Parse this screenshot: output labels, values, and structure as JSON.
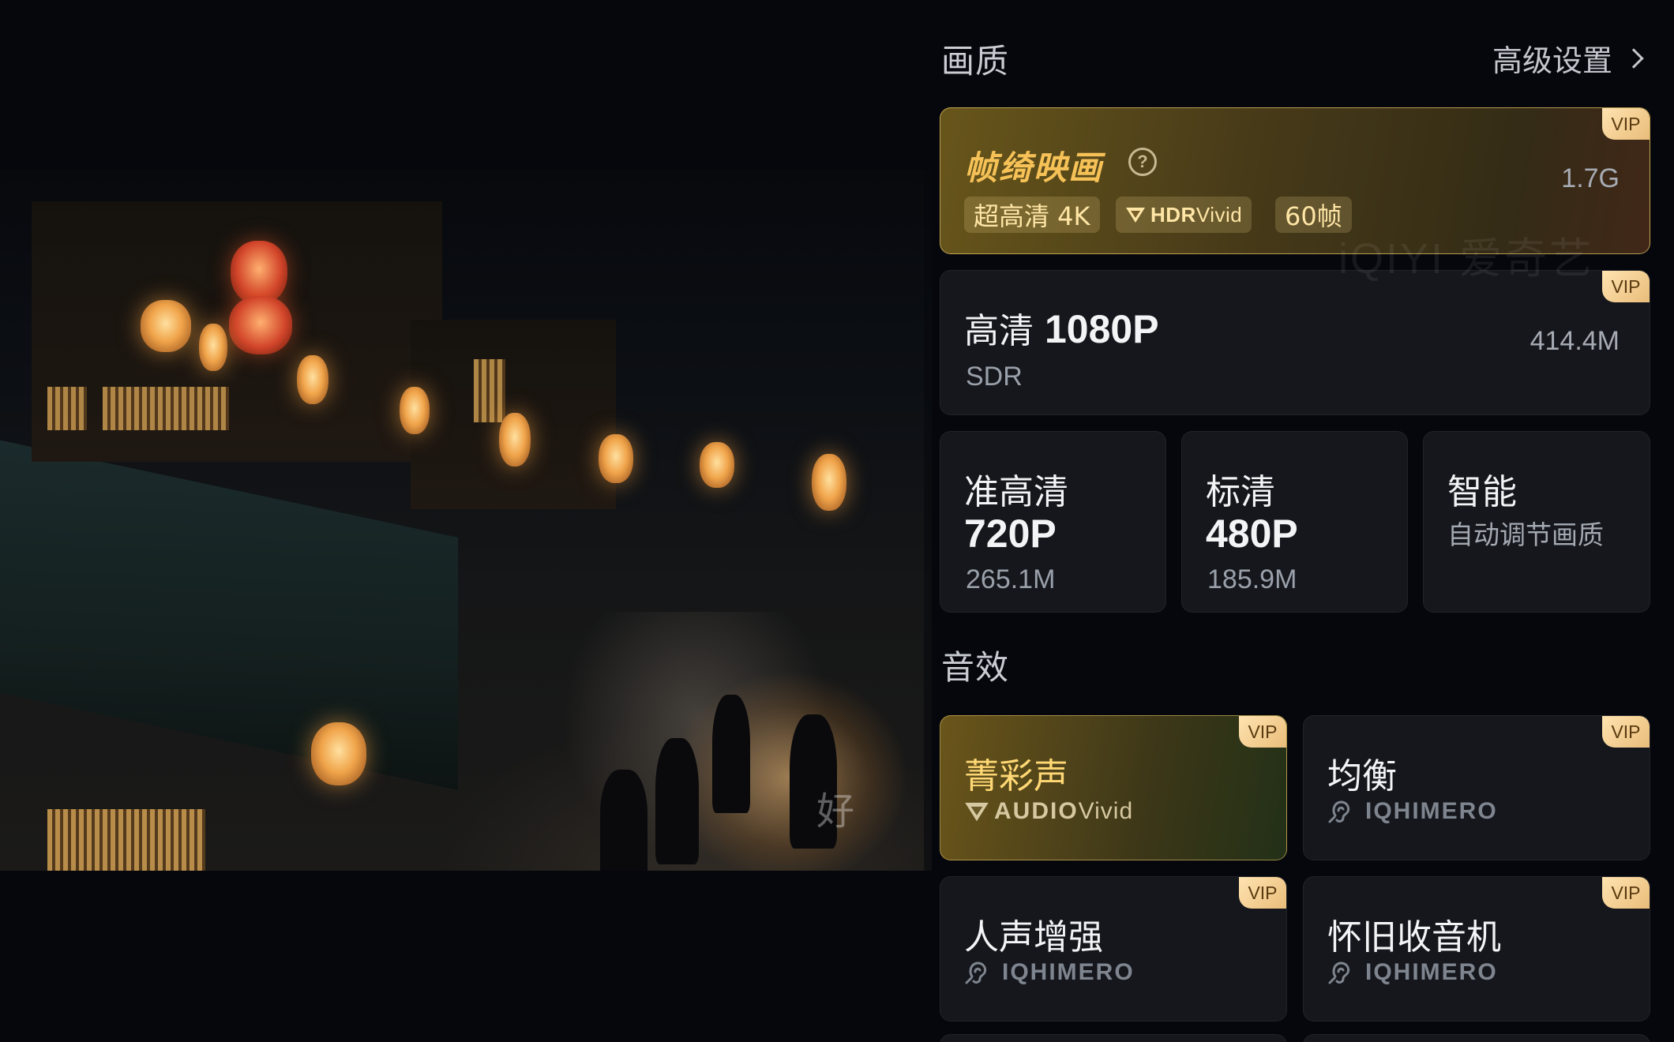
{
  "video": {
    "subtitle_char": "好"
  },
  "quality": {
    "section_title": "画质",
    "advanced_settings": "高级设置",
    "premium": {
      "title": "帧绮映画",
      "tags": [
        "超高清 4K",
        "HDR Vivid",
        "60帧"
      ],
      "tag_hdr_bold": "HDR",
      "tag_hdr_thin": "Vivid",
      "size": "1.7G",
      "vip": "VIP"
    },
    "hd1080": {
      "name": "高清",
      "res": "1080P",
      "sub": "SDR",
      "size": "414.4M",
      "vip": "VIP"
    },
    "hd720": {
      "name": "准高清",
      "res": "720P",
      "size": "265.1M"
    },
    "sd480": {
      "name": "标清",
      "res": "480P",
      "size": "185.9M"
    },
    "auto": {
      "name": "智能",
      "sub": "自动调节画质"
    },
    "watermark": "iQIYI 爱奇艺"
  },
  "audio": {
    "section_title": "音效",
    "items": [
      {
        "title": "菁彩声",
        "sub_bold": "AUDIO",
        "sub_thin": "Vivid",
        "vip": "VIP",
        "selected": true
      },
      {
        "title": "均衡",
        "sub": "IQHIMERO",
        "vip": "VIP"
      },
      {
        "title": "人声增强",
        "sub": "IQHIMERO",
        "vip": "VIP"
      },
      {
        "title": "怀旧收音机",
        "sub": "IQHIMERO",
        "vip": "VIP"
      }
    ]
  },
  "colors": {
    "accent_gold": "#f6c257",
    "vip_badge": "#e9bd7a",
    "panel_bg": "#05070c"
  }
}
